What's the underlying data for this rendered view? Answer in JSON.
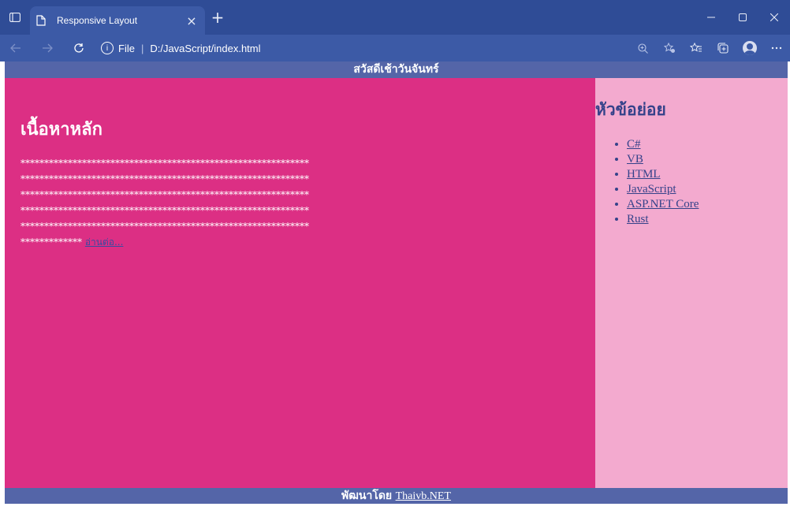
{
  "browser": {
    "tab_title": "Responsive Layout",
    "tab_close": "×",
    "new_tab": "+",
    "url_prefix": "File",
    "url_separator": "|",
    "url": "D:/JavaScript/index.html",
    "accent": "#2f4c96"
  },
  "page": {
    "header_text": "สวัสดีเช้าวันจันทร์",
    "main": {
      "heading": "เนื้อหาหลัก",
      "star_lines": [
        "*************************************************************",
        "*************************************************************",
        "*************************************************************",
        "*************************************************************",
        "*************************************************************"
      ],
      "last_line": "*************",
      "read_more": "อ่านต่อ..."
    },
    "aside": {
      "heading": "หัวข้อย่อย",
      "links": [
        "C#",
        "VB",
        "HTML",
        "JavaScript",
        "ASP.NET Core",
        "Rust"
      ]
    },
    "footer": {
      "by": "พัฒนาโดย",
      "link": "Thaivb.NET"
    },
    "colors": {
      "header": "#5465a8",
      "main": "#dc2f84",
      "aside": "#f3aacf"
    }
  }
}
